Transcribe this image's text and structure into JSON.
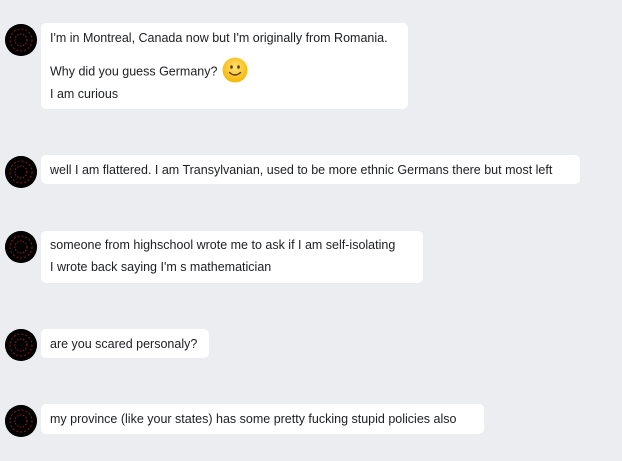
{
  "messages": [
    {
      "lines": [
        "I'm in Montreal, Canada now but I'm originally from Romania.",
        "Why did you guess Germany?",
        "I am curious"
      ],
      "emoji": "slightly-smiling-face-icon"
    },
    {
      "lines": [
        "well I am flattered. I am Transylvanian, used to be more ethnic Germans there but most left"
      ]
    },
    {
      "lines": [
        "someone from highschool wrote me to ask if I am self-isolating",
        "I wrote back saying I'm s mathematician"
      ]
    },
    {
      "lines": [
        "are you scared personaly?"
      ]
    },
    {
      "lines": [
        "my province (like your states) has some pretty fucking stupid policies also"
      ]
    }
  ],
  "colors": {
    "background": "#ebedf0",
    "bubble": "#ffffff",
    "text": "#1c1e21",
    "avatar": "#000000",
    "avatar_accent": "#8b1a1a",
    "emoji_face": "#ffcc33"
  }
}
